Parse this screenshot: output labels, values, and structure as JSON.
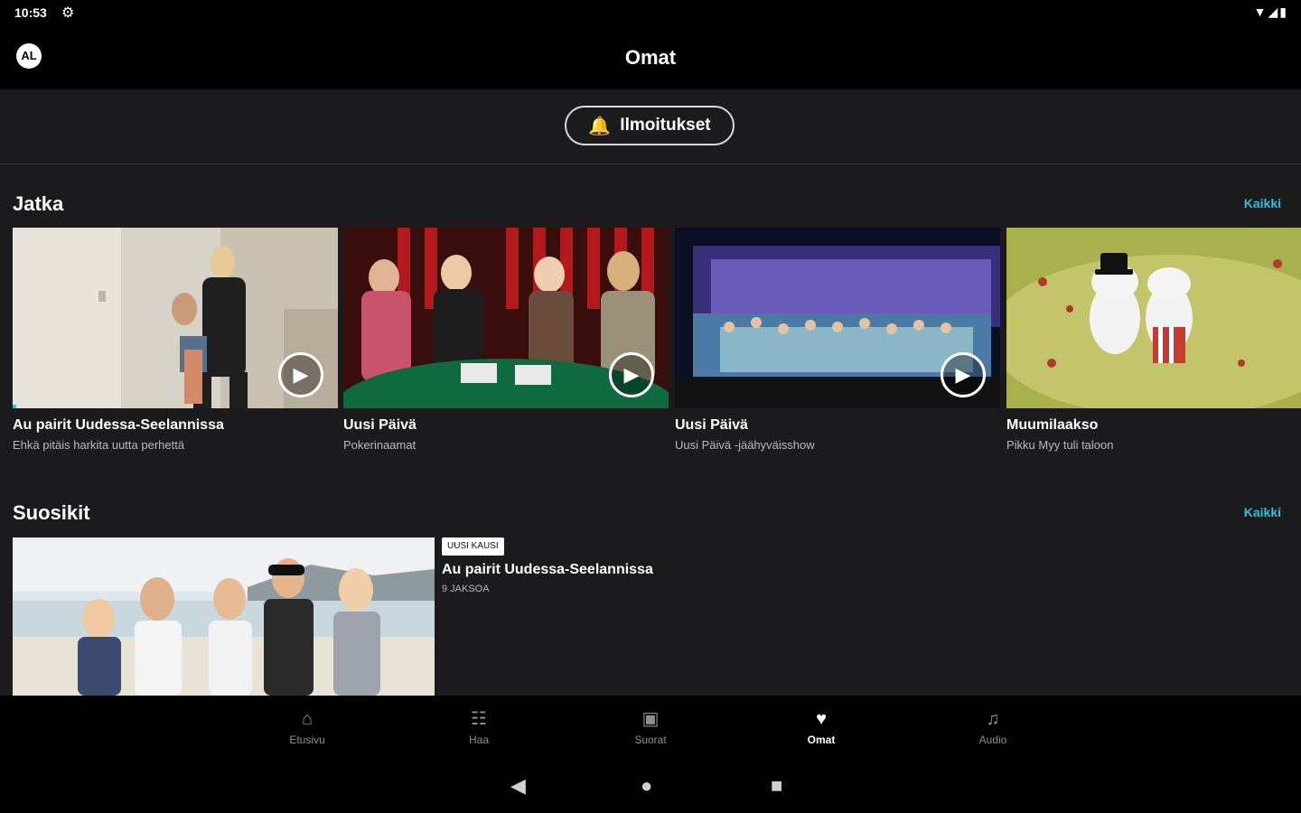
{
  "status_bar": {
    "time": "10:53",
    "settings_icon": "gear-icon",
    "right_icons": "▼◢▮"
  },
  "app_bar": {
    "avatar_initials": "AL",
    "title": "Omat"
  },
  "notifications_button": {
    "label": "Ilmoitukset",
    "icon": "bell-icon"
  },
  "sections": {
    "continue": {
      "title": "Jatka",
      "all_link": "Kaikki",
      "items": [
        {
          "title": "Au pairit Uudessa-Seelannissa",
          "subtitle": "Ehkä pitäis harkita uutta perhettä",
          "progress": 0.01
        },
        {
          "title": "Uusi Päivä",
          "subtitle": "Pokerinaamat",
          "progress": 0
        },
        {
          "title": "Uusi Päivä",
          "subtitle": "Uusi Päivä -jäähyväisshow",
          "progress": 0
        },
        {
          "title": "Muumilaakso",
          "subtitle": "Pikku Myy tuli taloon",
          "progress": 0
        }
      ]
    },
    "favorites": {
      "title": "Suosikit",
      "all_link": "Kaikki",
      "item": {
        "badge": "UUSI KAUSI",
        "title": "Au pairit Uudessa-Seelannissa",
        "subtitle": "9 JAKSOA"
      }
    }
  },
  "bottom_nav": [
    {
      "label": "Etusivu",
      "icon": "home-icon",
      "active": false
    },
    {
      "label": "Haa",
      "icon": "search-icon",
      "active": false
    },
    {
      "label": "Suorat",
      "icon": "live-tv-icon",
      "active": false
    },
    {
      "label": "Omat",
      "icon": "heart-icon",
      "active": true
    },
    {
      "label": "Audio",
      "icon": "headphones-icon",
      "active": false
    }
  ],
  "colors": {
    "accent": "#28c3e0",
    "background": "#1b1b1d",
    "bar": "#000000"
  }
}
